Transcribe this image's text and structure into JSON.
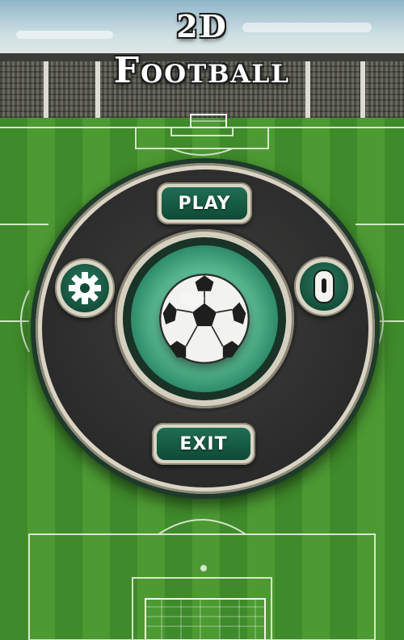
{
  "title": {
    "line1": "2D",
    "line2": "Football"
  },
  "menu": {
    "play_label": "PLAY",
    "exit_label": "EXIT"
  },
  "icons": {
    "left_button": "gear-icon",
    "right_button": "kit-icon",
    "center": "soccer-ball-icon"
  },
  "colors": {
    "button_green": "#13573f",
    "dial_dark": "#2a2b2a",
    "ring": "#d9d4c4",
    "pitch_light": "#4d9a33",
    "pitch_dark": "#3f8a2a"
  }
}
